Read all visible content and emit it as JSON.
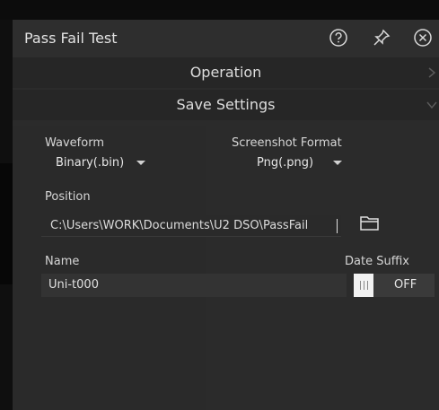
{
  "dialog": {
    "title": "Pass Fail Test"
  },
  "sections": {
    "operation_label": "Operation",
    "save_settings_label": "Save Settings"
  },
  "waveform": {
    "label": "Waveform",
    "value": "Binary(.bin)"
  },
  "screenshot_format": {
    "label": "Screenshot Format",
    "value": "Png(.png)"
  },
  "position": {
    "label": "Position",
    "value": "C:\\Users\\WORK\\Documents\\U2 DSO\\PassFail"
  },
  "name": {
    "label": "Name",
    "value": "Uni-t000"
  },
  "date_suffix": {
    "label": "Date Suffix",
    "state": "OFF"
  },
  "icons": [
    "help-icon",
    "pin-icon",
    "close-icon",
    "chevron-right-icon",
    "chevron-down-icon",
    "folder-icon"
  ]
}
